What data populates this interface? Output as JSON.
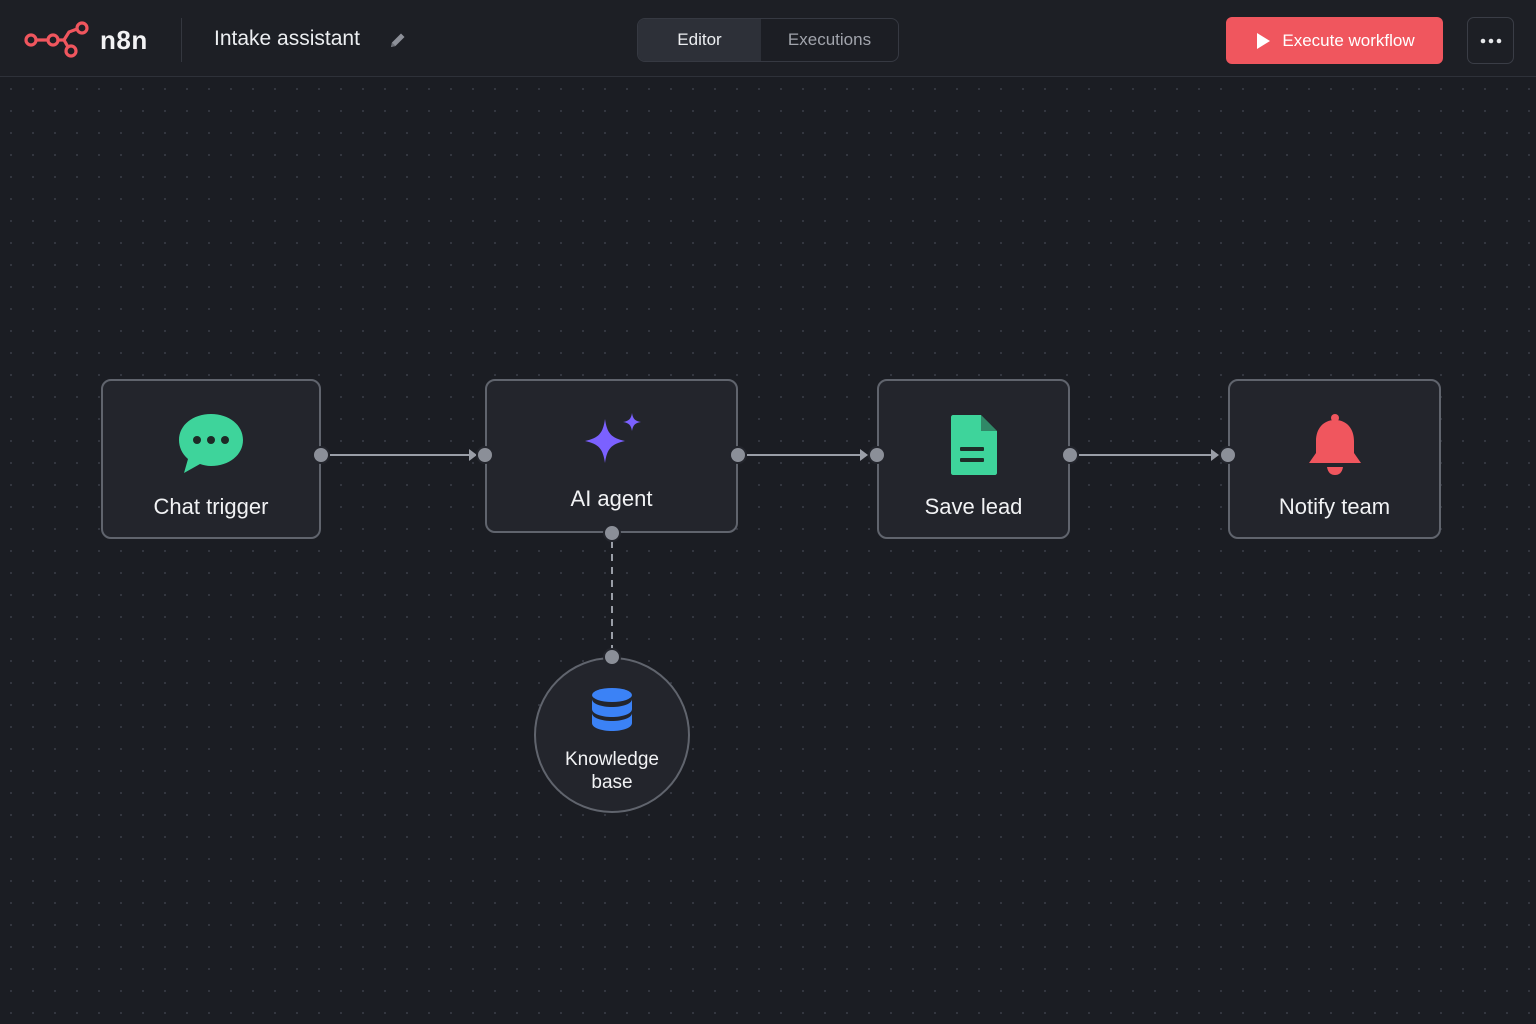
{
  "app": {
    "name": "n8n",
    "logo_color": "#f0565e"
  },
  "workflow": {
    "name": "Intake assistant"
  },
  "tabs": [
    {
      "label": "Editor",
      "active": true
    },
    {
      "label": "Executions",
      "active": false
    }
  ],
  "actions": {
    "execute_label": "Execute workflow",
    "more_icon": "ellipsis-icon"
  },
  "nodes": {
    "chat_trigger": {
      "label": "Chat trigger",
      "icon": "chat-bubble-icon",
      "color": "#3ed49b"
    },
    "ai_agent": {
      "label": "AI agent",
      "icon": "sparkle-icon",
      "color": "#7b61ff"
    },
    "save_lead": {
      "label": "Save lead",
      "icon": "document-icon",
      "color": "#3ed49b"
    },
    "notify_team": {
      "label": "Notify team",
      "icon": "bell-icon",
      "color": "#f0565e"
    },
    "knowledge_base": {
      "label_line1": "Knowledge",
      "label_line2": "base",
      "icon": "database-icon",
      "color": "#3b82f6"
    }
  },
  "colors": {
    "accent": "#f0565e",
    "canvas": "#1b1d23",
    "node_bg": "#23252c",
    "connector": "#8b8f98"
  }
}
